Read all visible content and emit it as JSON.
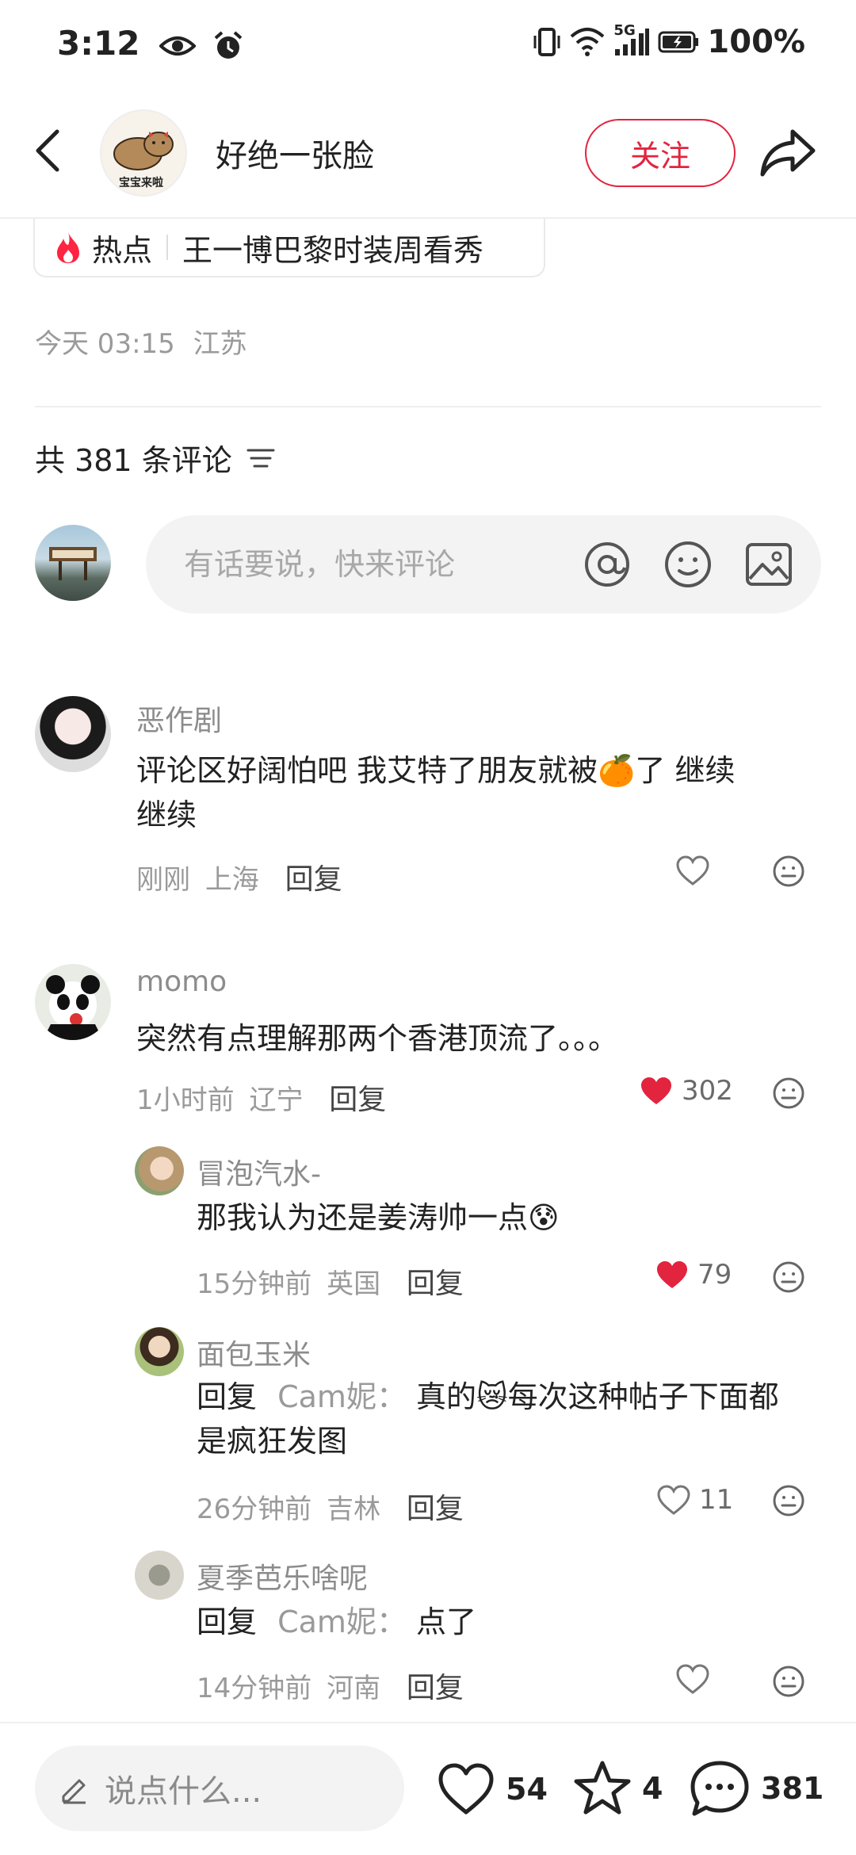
{
  "status": {
    "time": "3:12",
    "network": "5G",
    "battery": "100%"
  },
  "header": {
    "author_name": "好绝一张脸",
    "follow_label": "关注",
    "author_avatar_text": "宝宝来啦"
  },
  "hot_tag": {
    "label": "热点",
    "topic": "王一博巴黎时装周看秀"
  },
  "post_meta": {
    "date": "今天 03:15",
    "location": "江苏"
  },
  "comments_header": {
    "count_text": "共 381 条评论"
  },
  "comment_input": {
    "placeholder": "有话要说，快来评论"
  },
  "comments": [
    {
      "name": "恶作剧",
      "text_line1": "评论区好阔怕吧 我艾特了朋友就被🍊了 继续",
      "text_line2": "继续",
      "time": "刚刚",
      "location": "上海",
      "reply_label": "回复",
      "likes": "",
      "liked": false
    },
    {
      "name": "momo",
      "text_line1": "突然有点理解那两个香港顶流了。。。",
      "time": "1小时前",
      "location": "辽宁",
      "reply_label": "回复",
      "likes": "302",
      "liked": true,
      "replies": [
        {
          "name": "冒泡汽水-",
          "text": "那我认为还是姜涛帅一点😰",
          "time": "15分钟前",
          "location": "英国",
          "reply_label": "回复",
          "likes": "79",
          "liked": true
        },
        {
          "name": "面包玉米",
          "reply_prefix": "回复",
          "reply_to": "Cam妮：",
          "text_line1": "真的😿每次这种帖子下面都",
          "text_line2": "是疯狂发图",
          "time": "26分钟前",
          "location": "吉林",
          "reply_label": "回复",
          "likes": "11",
          "liked": false
        },
        {
          "name": "夏季芭乐啥呢",
          "reply_prefix": "回复",
          "reply_to": "Cam妮：",
          "text": "点了",
          "time": "14分钟前",
          "location": "河南",
          "reply_label": "回复",
          "likes": "",
          "liked": false
        }
      ]
    }
  ],
  "bottom_bar": {
    "input_placeholder": "说点什么...",
    "like_count": "54",
    "star_count": "4",
    "comment_count": "381"
  },
  "colors": {
    "accent": "#e2243f",
    "muted": "#9a9a9a",
    "text": "#222222"
  }
}
